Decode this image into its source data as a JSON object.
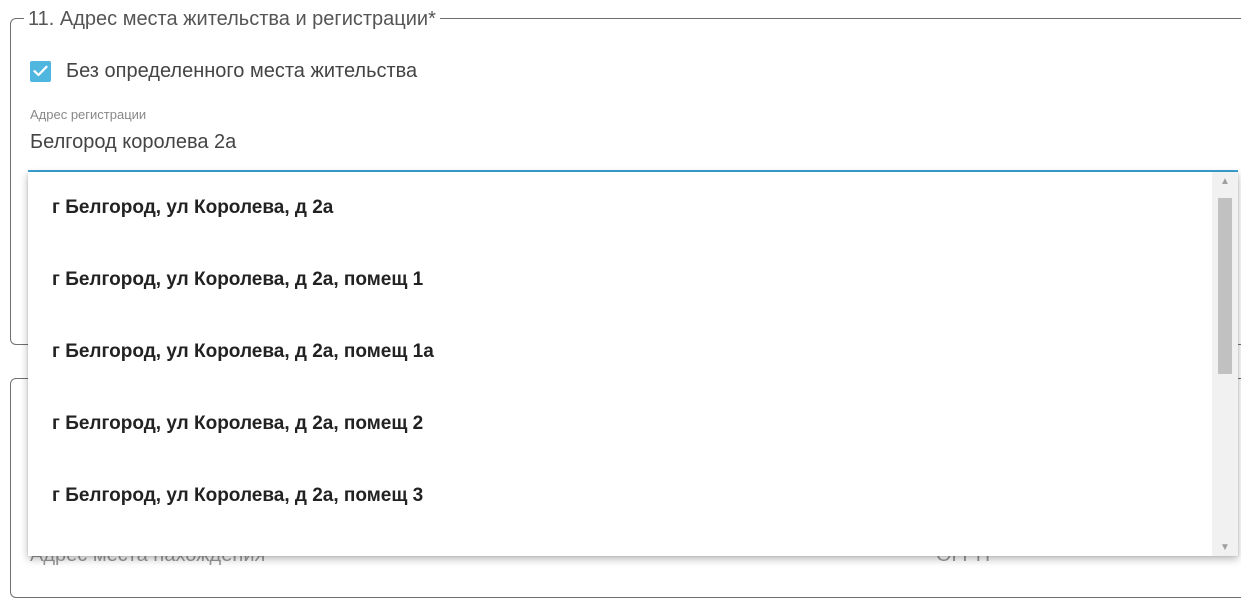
{
  "section": {
    "legend": "11. Адрес места жительства и регистрации*"
  },
  "checkbox": {
    "checked": true,
    "label": "Без определенного места жительства"
  },
  "registration_address": {
    "label": "Адрес регистрации",
    "value": "Белгород королева 2а"
  },
  "dropdown": {
    "options": [
      "г Белгород, ул Королева, д 2а",
      "г Белгород, ул Королева, д 2а, помещ 1",
      "г Белгород, ул Королева, д 2а, помещ 1а",
      "г Белгород, ул Королева, д 2а, помещ 2",
      "г Белгород, ул Королева, д 2а, помещ 3"
    ]
  },
  "background_text": {
    "left": "Адрес места нахождения",
    "right": "ОГРН",
    "colon": ":"
  },
  "colors": {
    "accent": "#4fb6e0",
    "underline": "#3aa6d6"
  }
}
